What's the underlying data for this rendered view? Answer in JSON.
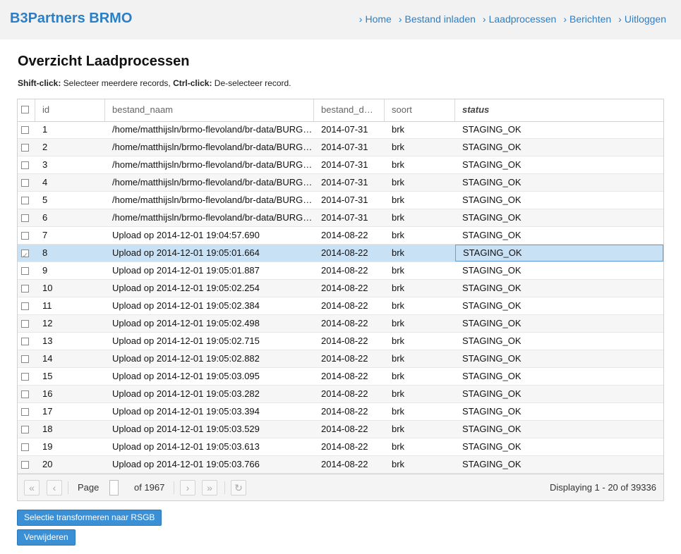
{
  "app": {
    "brand": "B3Partners BRMO"
  },
  "nav": [
    "Home",
    "Bestand inladen",
    "Laadprocessen",
    "Berichten",
    "Uitloggen"
  ],
  "page": {
    "title": "Overzicht Laadprocessen",
    "hint": {
      "shift_key": "Shift-click:",
      "shift_text": " Selecteer meerdere records, ",
      "ctrl_key": "Ctrl-click:",
      "ctrl_text": " De-selecteer record."
    }
  },
  "grid": {
    "columns": [
      "id",
      "bestand_naam",
      "bestand_d…",
      "soort",
      "status"
    ],
    "rows": [
      {
        "id": "1",
        "bestand_naam": "/home/matthijsln/brmo-flevoland/br-data/BURGERPROCES…",
        "bestand_datum": "2014-07-31",
        "soort": "brk",
        "status": "STAGING_OK",
        "checked": false
      },
      {
        "id": "2",
        "bestand_naam": "/home/matthijsln/brmo-flevoland/br-data/BURGERPROCES…",
        "bestand_datum": "2014-07-31",
        "soort": "brk",
        "status": "STAGING_OK",
        "checked": false
      },
      {
        "id": "3",
        "bestand_naam": "/home/matthijsln/brmo-flevoland/br-data/BURGERPROCES…",
        "bestand_datum": "2014-07-31",
        "soort": "brk",
        "status": "STAGING_OK",
        "checked": false
      },
      {
        "id": "4",
        "bestand_naam": "/home/matthijsln/brmo-flevoland/br-data/BURGERPROCES…",
        "bestand_datum": "2014-07-31",
        "soort": "brk",
        "status": "STAGING_OK",
        "checked": false
      },
      {
        "id": "5",
        "bestand_naam": "/home/matthijsln/brmo-flevoland/br-data/BURGERPROCES…",
        "bestand_datum": "2014-07-31",
        "soort": "brk",
        "status": "STAGING_OK",
        "checked": false
      },
      {
        "id": "6",
        "bestand_naam": "/home/matthijsln/brmo-flevoland/br-data/BURGERPROCES…",
        "bestand_datum": "2014-07-31",
        "soort": "brk",
        "status": "STAGING_OK",
        "checked": false
      },
      {
        "id": "7",
        "bestand_naam": "Upload op 2014-12-01 19:04:57.690",
        "bestand_datum": "2014-08-22",
        "soort": "brk",
        "status": "STAGING_OK",
        "checked": false
      },
      {
        "id": "8",
        "bestand_naam": "Upload op 2014-12-01 19:05:01.664",
        "bestand_datum": "2014-08-22",
        "soort": "brk",
        "status": "STAGING_OK",
        "checked": true
      },
      {
        "id": "9",
        "bestand_naam": "Upload op 2014-12-01 19:05:01.887",
        "bestand_datum": "2014-08-22",
        "soort": "brk",
        "status": "STAGING_OK",
        "checked": false
      },
      {
        "id": "10",
        "bestand_naam": "Upload op 2014-12-01 19:05:02.254",
        "bestand_datum": "2014-08-22",
        "soort": "brk",
        "status": "STAGING_OK",
        "checked": false
      },
      {
        "id": "11",
        "bestand_naam": "Upload op 2014-12-01 19:05:02.384",
        "bestand_datum": "2014-08-22",
        "soort": "brk",
        "status": "STAGING_OK",
        "checked": false
      },
      {
        "id": "12",
        "bestand_naam": "Upload op 2014-12-01 19:05:02.498",
        "bestand_datum": "2014-08-22",
        "soort": "brk",
        "status": "STAGING_OK",
        "checked": false
      },
      {
        "id": "13",
        "bestand_naam": "Upload op 2014-12-01 19:05:02.715",
        "bestand_datum": "2014-08-22",
        "soort": "brk",
        "status": "STAGING_OK",
        "checked": false
      },
      {
        "id": "14",
        "bestand_naam": "Upload op 2014-12-01 19:05:02.882",
        "bestand_datum": "2014-08-22",
        "soort": "brk",
        "status": "STAGING_OK",
        "checked": false
      },
      {
        "id": "15",
        "bestand_naam": "Upload op 2014-12-01 19:05:03.095",
        "bestand_datum": "2014-08-22",
        "soort": "brk",
        "status": "STAGING_OK",
        "checked": false
      },
      {
        "id": "16",
        "bestand_naam": "Upload op 2014-12-01 19:05:03.282",
        "bestand_datum": "2014-08-22",
        "soort": "brk",
        "status": "STAGING_OK",
        "checked": false
      },
      {
        "id": "17",
        "bestand_naam": "Upload op 2014-12-01 19:05:03.394",
        "bestand_datum": "2014-08-22",
        "soort": "brk",
        "status": "STAGING_OK",
        "checked": false
      },
      {
        "id": "18",
        "bestand_naam": "Upload op 2014-12-01 19:05:03.529",
        "bestand_datum": "2014-08-22",
        "soort": "brk",
        "status": "STAGING_OK",
        "checked": false
      },
      {
        "id": "19",
        "bestand_naam": "Upload op 2014-12-01 19:05:03.613",
        "bestand_datum": "2014-08-22",
        "soort": "brk",
        "status": "STAGING_OK",
        "checked": false
      },
      {
        "id": "20",
        "bestand_naam": "Upload op 2014-12-01 19:05:03.766",
        "bestand_datum": "2014-08-22",
        "soort": "brk",
        "status": "STAGING_OK",
        "checked": false
      }
    ]
  },
  "pager": {
    "page_label": "Page",
    "page_value": "",
    "of_label": "of 1967",
    "display_text": "Displaying 1 - 20 of 39336",
    "icons": [
      "first-page-icon",
      "previous-page-icon",
      "next-page-icon",
      "last-page-icon",
      "refresh-icon"
    ]
  },
  "actions": {
    "transform_label": "Selectie transformeren naar RSGB",
    "delete_label": "Verwijderen"
  },
  "colors": {
    "brand": "#2a7fc7",
    "button": "#3b8fd4",
    "selected_row": "#c9e1f5"
  }
}
